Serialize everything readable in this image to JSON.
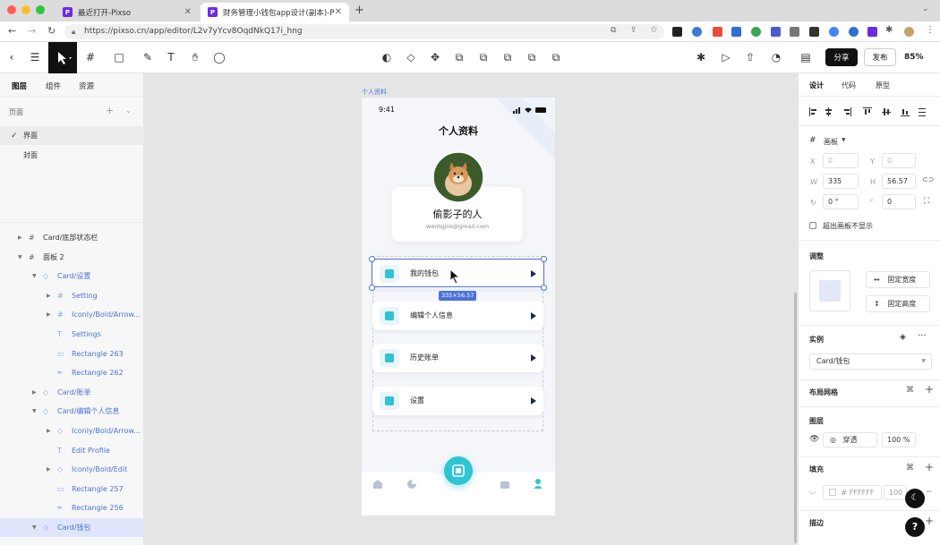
{
  "browser": {
    "tabs": [
      {
        "label": "最近打开-Pixso"
      },
      {
        "label": "财务管理小钱包app设计(副本)-P"
      }
    ],
    "url": "https://pixso.cn/app/editor/L2v7yYcv8OqdNkQ17i_hng"
  },
  "toolbar": {
    "share_label": "分享",
    "publish_label": "发布",
    "zoom": "85%"
  },
  "left_panel": {
    "tabs": [
      "图层",
      "组件",
      "资源"
    ],
    "pages_label": "页面",
    "pages": [
      {
        "label": "界面",
        "selected": true
      },
      {
        "label": "封面",
        "selected": false
      }
    ],
    "layers": [
      {
        "label": "Card/底部状态栏",
        "indent": 0,
        "kind": "frame",
        "blue": false
      },
      {
        "label": "面板 2",
        "indent": 0,
        "kind": "frame",
        "blue": false
      },
      {
        "label": "Card/设置",
        "indent": 1,
        "kind": "component",
        "blue": true
      },
      {
        "label": "Setting",
        "indent": 2,
        "kind": "frame",
        "blue": true
      },
      {
        "label": "Iconly/Bold/Arrow...",
        "indent": 2,
        "kind": "frame",
        "blue": true
      },
      {
        "label": "Settings",
        "indent": 2,
        "kind": "text",
        "blue": true
      },
      {
        "label": "Rectangle 263",
        "indent": 2,
        "kind": "rect",
        "blue": true
      },
      {
        "label": "Rectangle 262",
        "indent": 2,
        "kind": "line",
        "blue": true
      },
      {
        "label": "Card/账单",
        "indent": 1,
        "kind": "component",
        "blue": true
      },
      {
        "label": "Card/编辑个人信息",
        "indent": 1,
        "kind": "component",
        "blue": true
      },
      {
        "label": "Iconly/Bold/Arrow...",
        "indent": 2,
        "kind": "component",
        "blue": true
      },
      {
        "label": "Edit Profile",
        "indent": 2,
        "kind": "text",
        "blue": true
      },
      {
        "label": "Iconly/Bold/Edit",
        "indent": 2,
        "kind": "component",
        "blue": true
      },
      {
        "label": "Rectangle 257",
        "indent": 2,
        "kind": "rect",
        "blue": true
      },
      {
        "label": "Rectangle 256",
        "indent": 2,
        "kind": "line",
        "blue": true
      },
      {
        "label": "Card/钱包",
        "indent": 1,
        "kind": "component",
        "blue": true,
        "selected": true
      }
    ]
  },
  "canvas": {
    "frame_label": "个人资料",
    "phone": {
      "time": "9:41",
      "title": "个人资料",
      "name": "偷影子的人",
      "email": "wenlsjjns@gmail.com",
      "menu": [
        {
          "label": "我的钱包",
          "icon": "wallet-icon"
        },
        {
          "label": "编辑个人信息",
          "icon": "edit-icon"
        },
        {
          "label": "历史账单",
          "icon": "document-icon"
        },
        {
          "label": "设置",
          "icon": "gear-icon"
        }
      ],
      "size_badge": "335×56.57"
    }
  },
  "right_panel": {
    "tabs": [
      "设计",
      "代码",
      "原型"
    ],
    "frame_type": "画板",
    "x": "0",
    "y": "0",
    "w": "335",
    "h": "56.57",
    "rotation": "0 °",
    "radius": "0",
    "clip_label": "超出画板不显示",
    "adjust_label": "调整",
    "fixed_width": "固定宽度",
    "fixed_height": "固定高度",
    "instance_label": "实例",
    "instance_value": "Card/钱包",
    "layout_grid_label": "布局网格",
    "layer_label": "图层",
    "blend": "穿透",
    "opacity": "100 %",
    "fill_label": "填充",
    "fill_color": "# FFFFFF",
    "fill_opacity": "100",
    "stroke_label": "描边"
  },
  "colors": {
    "accent": "#2ec4d4",
    "selection": "#4b72d9",
    "dark": "#1c2a4a"
  }
}
